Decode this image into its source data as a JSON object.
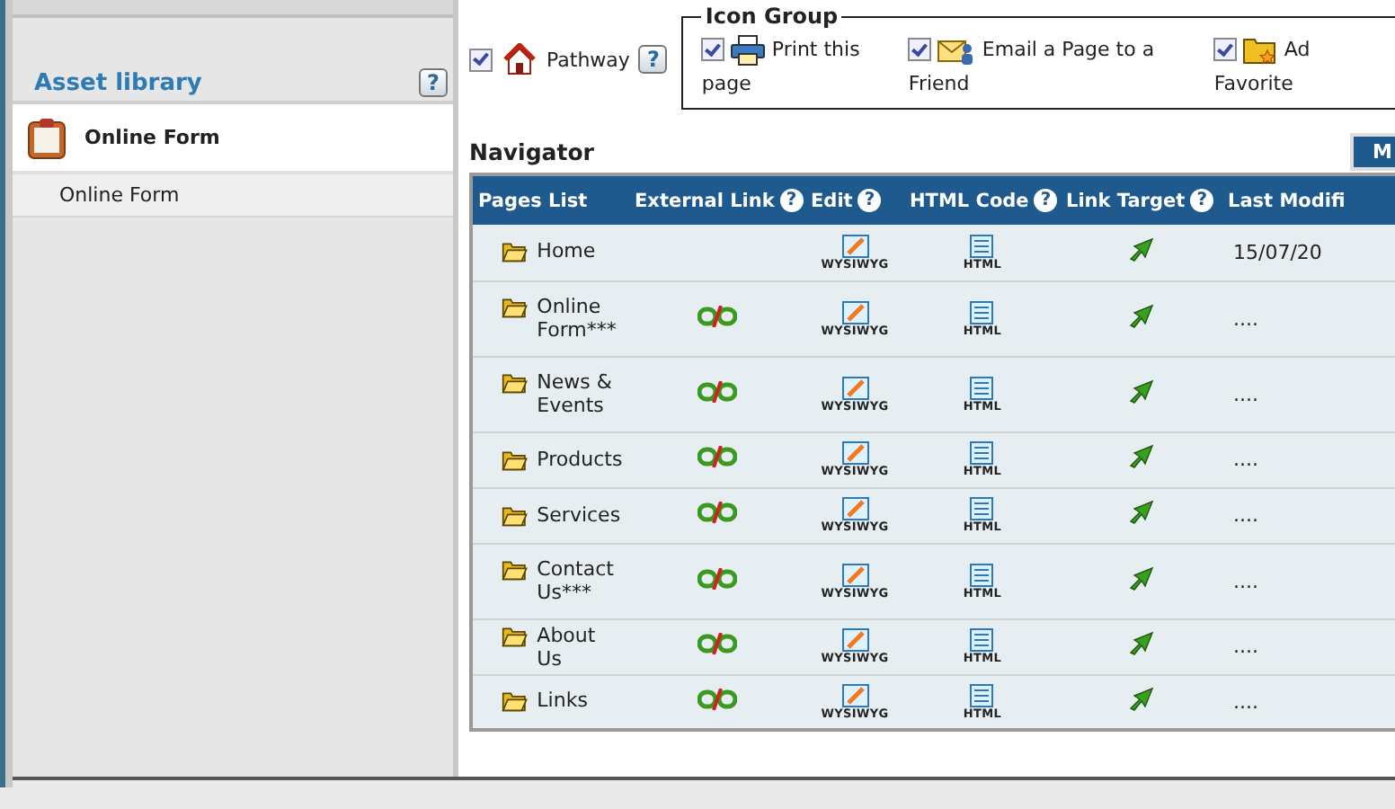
{
  "sidebar": {
    "title": "Asset library",
    "help": "?",
    "items": [
      {
        "label": "Online Form",
        "kind": "header"
      },
      {
        "label": "Online Form",
        "kind": "sub"
      }
    ]
  },
  "pathway": {
    "label": "Pathway",
    "checked": true,
    "help": "?"
  },
  "icon_group": {
    "legend": "Icon Group",
    "items": [
      {
        "lines": [
          "Print this",
          "page"
        ],
        "checked": true
      },
      {
        "lines": [
          "Email a Page to a",
          "Friend"
        ],
        "checked": true
      },
      {
        "lines": [
          "Ad",
          "Favorite"
        ],
        "checked": true
      }
    ]
  },
  "navigator": {
    "title": "Navigator",
    "button": "M"
  },
  "table": {
    "columns": [
      {
        "label": "Pages List"
      },
      {
        "label": "External Link",
        "help": "?"
      },
      {
        "label": "Edit",
        "help": "?"
      },
      {
        "label": "HTML Code",
        "help": "?"
      },
      {
        "label": "Link Target",
        "help": "?"
      },
      {
        "label": "Last Modifi"
      }
    ],
    "rows": [
      {
        "page": "Home",
        "external_link": false,
        "edit": "WYSIWYG",
        "html": "HTML",
        "modified": "15/07/20"
      },
      {
        "page": "Online Form***",
        "external_link": true,
        "edit": "WYSIWYG",
        "html": "HTML",
        "modified": "...."
      },
      {
        "page": "News & Events",
        "external_link": true,
        "edit": "WYSIWYG",
        "html": "HTML",
        "modified": "...."
      },
      {
        "page": "Products",
        "external_link": true,
        "edit": "WYSIWYG",
        "html": "HTML",
        "modified": "...."
      },
      {
        "page": "Services",
        "external_link": true,
        "edit": "WYSIWYG",
        "html": "HTML",
        "modified": "...."
      },
      {
        "page": "Contact Us***",
        "external_link": true,
        "edit": "WYSIWYG",
        "html": "HTML",
        "modified": "...."
      },
      {
        "page": "About Us",
        "external_link": true,
        "edit": "WYSIWYG",
        "html": "HTML",
        "modified": "...."
      },
      {
        "page": "Links",
        "external_link": true,
        "edit": "WYSIWYG",
        "html": "HTML",
        "modified": "...."
      }
    ]
  }
}
